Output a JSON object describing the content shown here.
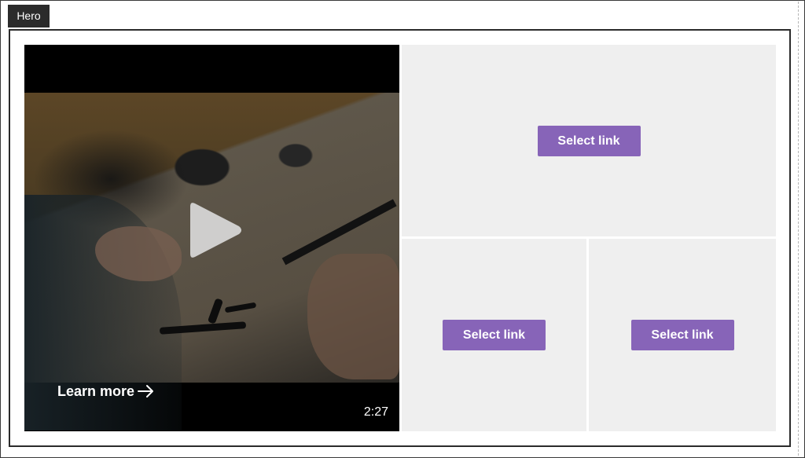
{
  "hero_tag": {
    "label": "Hero"
  },
  "video": {
    "learn_more_label": "Learn more",
    "duration": "2:27",
    "play_icon": "play-icon",
    "arrow_icon": "arrow-right-icon"
  },
  "tiles": [
    {
      "button_label": "Select link"
    },
    {
      "button_label": "Select link"
    },
    {
      "button_label": "Select link"
    }
  ],
  "colors": {
    "accent": "#8764b8",
    "tile_background": "#efefef",
    "tag_background": "#2b2b2b"
  }
}
